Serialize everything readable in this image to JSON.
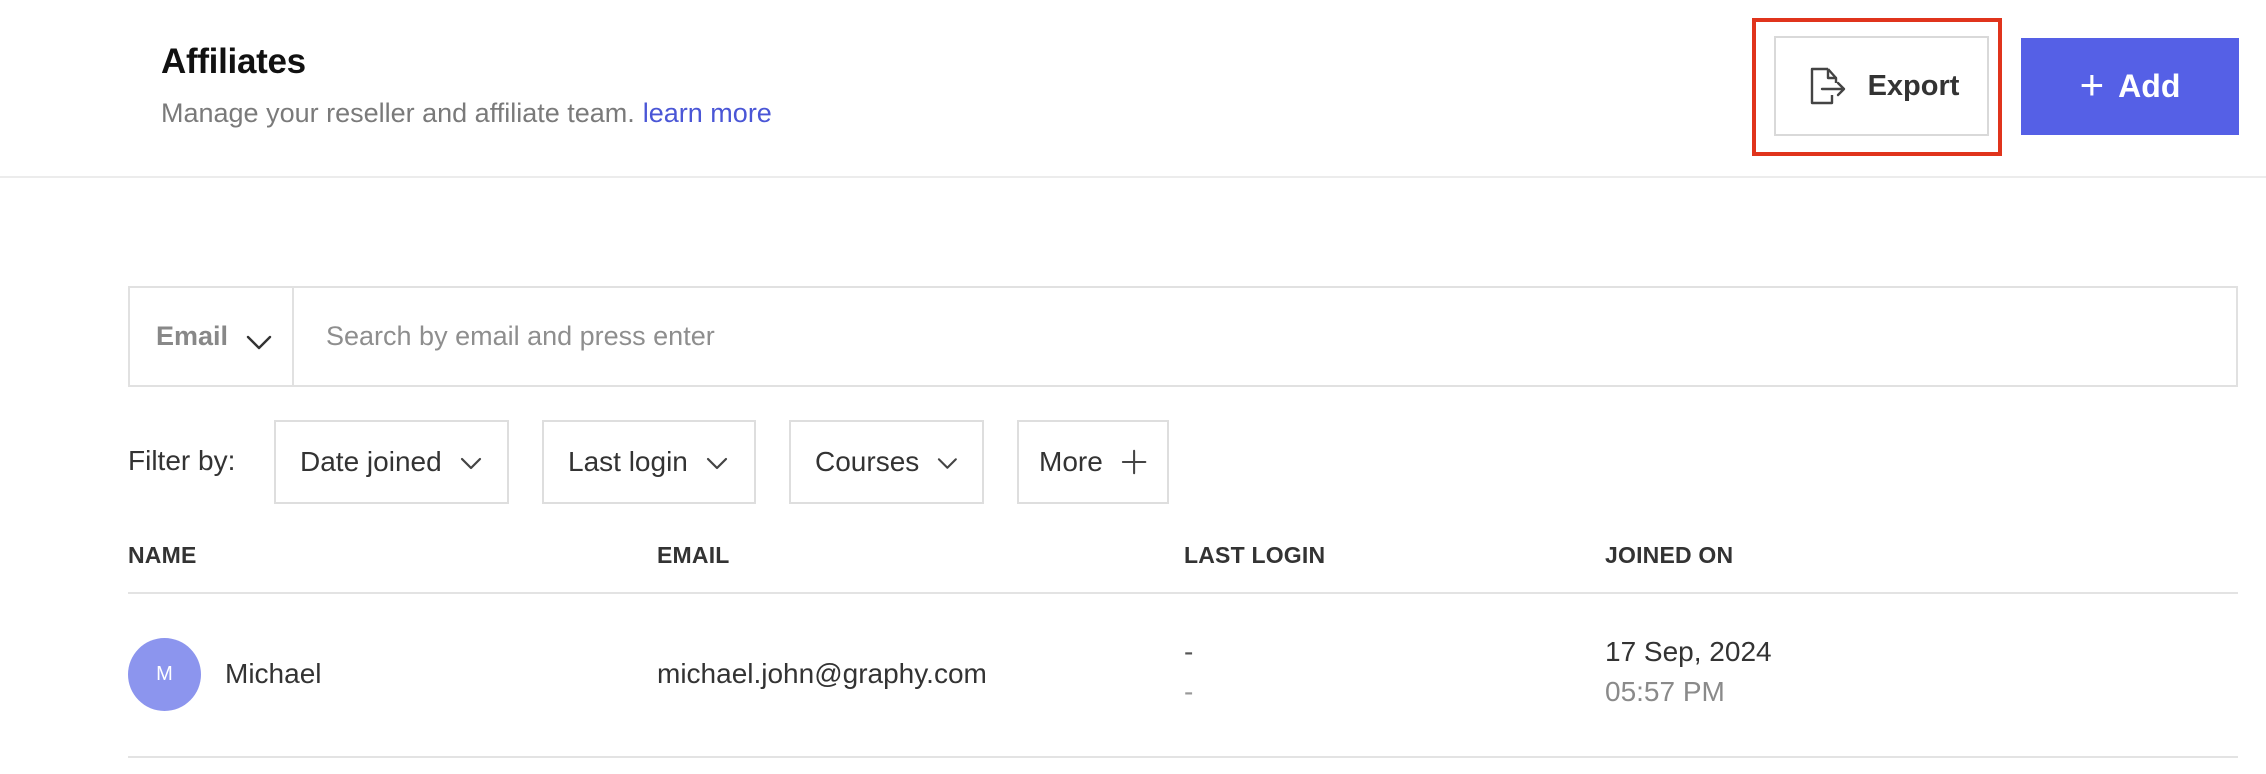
{
  "header": {
    "title": "Affiliates",
    "subtitle": "Manage your reseller and affiliate team.",
    "learn_more": "learn more",
    "export_label": "Export",
    "add_label": "Add",
    "add_icon": "plus-icon",
    "export_icon": "export-icon",
    "accent_color": "#5560e6",
    "highlight_color": "#e0341c"
  },
  "search": {
    "type_label": "Email",
    "placeholder": "Search by email and press enter",
    "value": ""
  },
  "filters": {
    "label": "Filter by:",
    "items": [
      {
        "label": "Date joined",
        "icon": "chevron-down-icon"
      },
      {
        "label": "Last login",
        "icon": "chevron-down-icon"
      },
      {
        "label": "Courses",
        "icon": "chevron-down-icon"
      },
      {
        "label": "More",
        "icon": "plus-icon"
      }
    ]
  },
  "table": {
    "columns": [
      "NAME",
      "EMAIL",
      "LAST LOGIN",
      "JOINED ON"
    ],
    "rows": [
      {
        "avatar_initial": "M",
        "name": "Michael",
        "email": "michael.john@graphy.com",
        "last_login_date": "-",
        "last_login_time": "-",
        "joined_date": "17 Sep, 2024",
        "joined_time": "05:57 PM"
      }
    ]
  }
}
